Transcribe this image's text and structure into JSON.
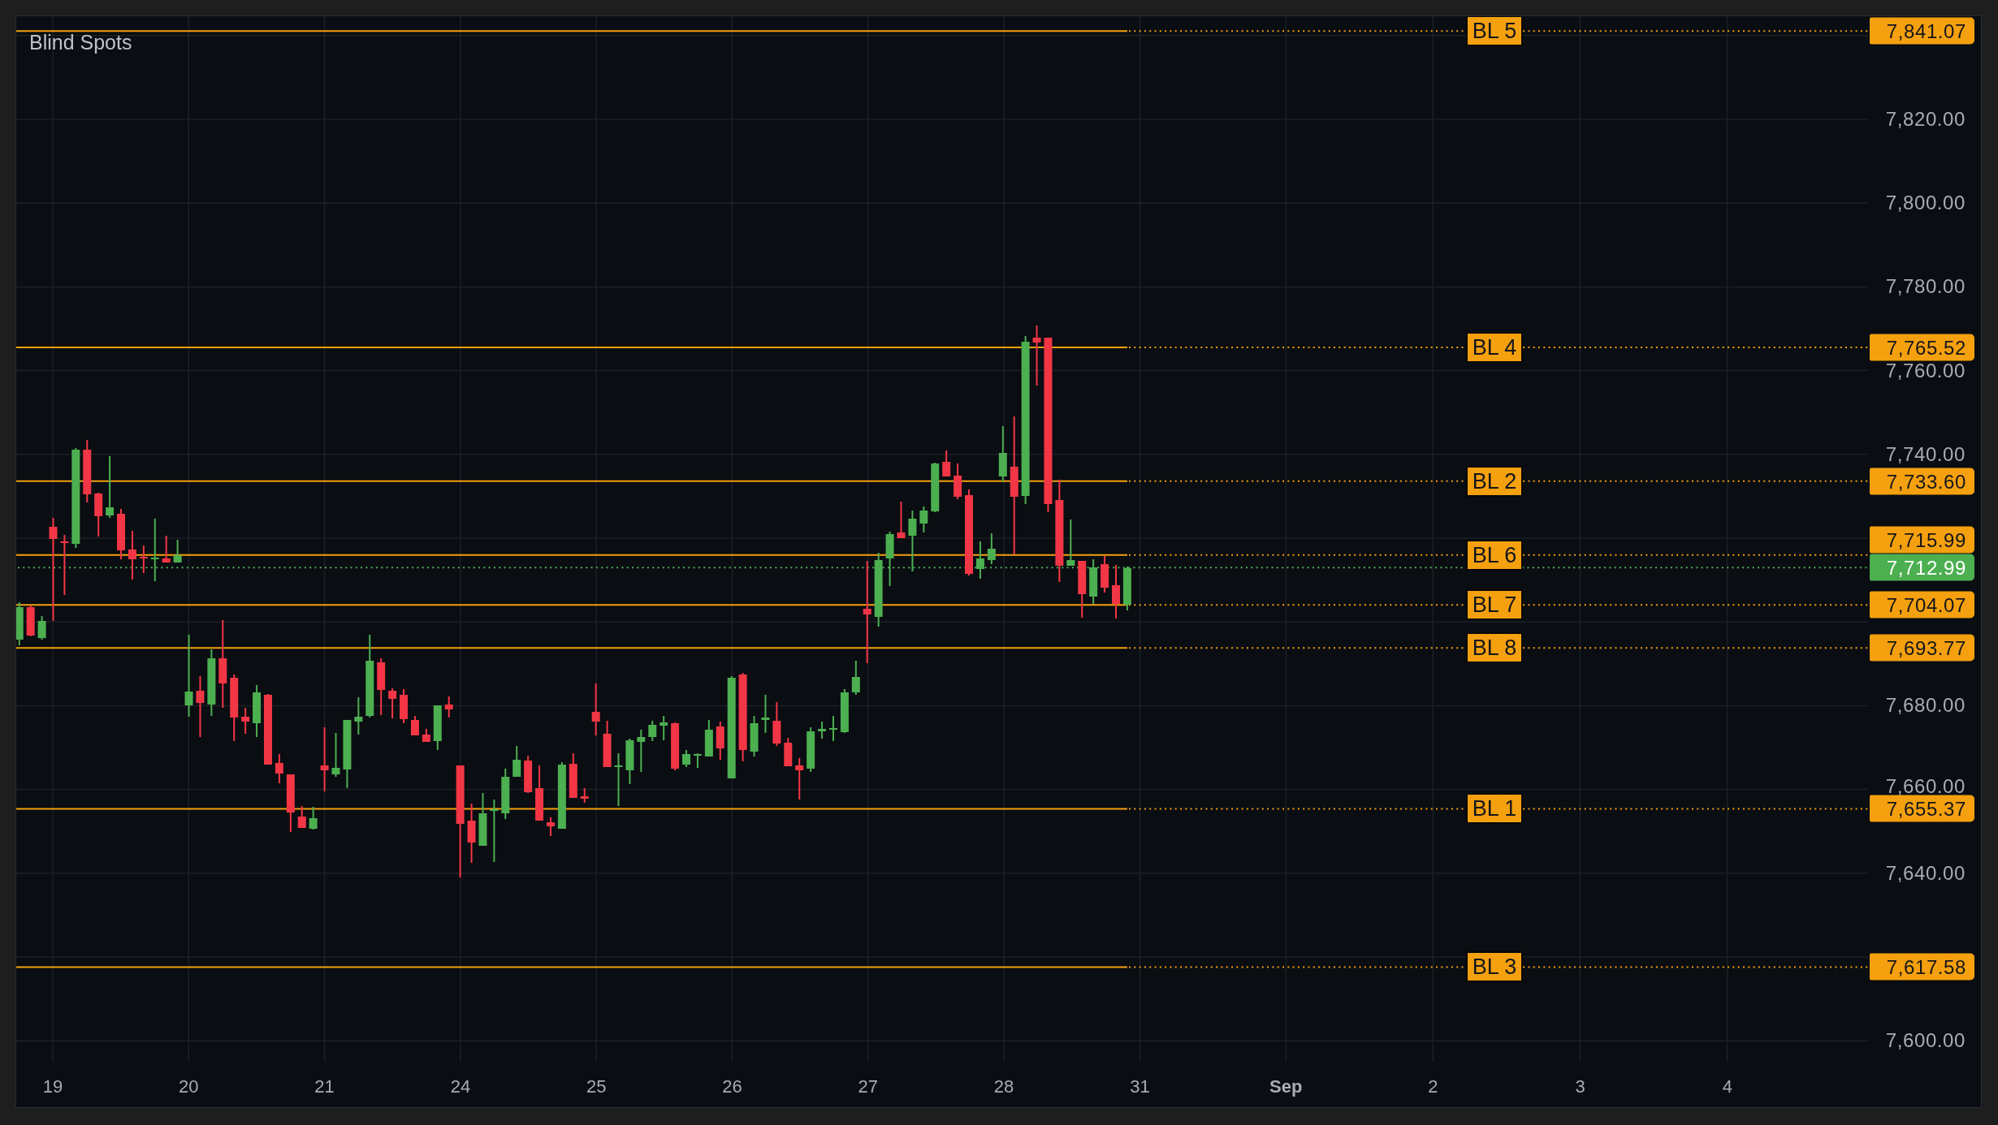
{
  "chart": {
    "title": "Blind Spots",
    "price_axis": {
      "labels": [
        "7,820.00",
        "7,800.00",
        "7,780.00",
        "7,760.00",
        "7,740.00",
        "7,680.00",
        "7,660.00",
        "7,640.00",
        "7,600.00"
      ]
    },
    "levels": [
      {
        "label": "BL 5",
        "price": "7,841.07"
      },
      {
        "label": "BL 4",
        "price": "7,765.52"
      },
      {
        "label": "BL 2",
        "price": "7,733.60"
      },
      {
        "label": "BL 6",
        "price": "7,715.99"
      },
      {
        "label": "BL 7",
        "price": "7,704.07"
      },
      {
        "label": "BL 8",
        "price": "7,693.77"
      },
      {
        "label": "BL 1",
        "price": "7,655.37"
      },
      {
        "label": "BL 3",
        "price": "7,617.58"
      }
    ],
    "last_price": {
      "price": "7,712.99"
    },
    "date_axis": {
      "labels": [
        {
          "text": "19",
          "kind": "day"
        },
        {
          "text": "20",
          "kind": "day"
        },
        {
          "text": "21",
          "kind": "day"
        },
        {
          "text": "24",
          "kind": "day"
        },
        {
          "text": "25",
          "kind": "day"
        },
        {
          "text": "26",
          "kind": "day"
        },
        {
          "text": "27",
          "kind": "day"
        },
        {
          "text": "28",
          "kind": "day"
        },
        {
          "text": "31",
          "kind": "day"
        },
        {
          "text": "Sep",
          "kind": "month"
        },
        {
          "text": "2",
          "kind": "day"
        },
        {
          "text": "3",
          "kind": "day"
        },
        {
          "text": "4",
          "kind": "day"
        }
      ]
    }
  }
}
